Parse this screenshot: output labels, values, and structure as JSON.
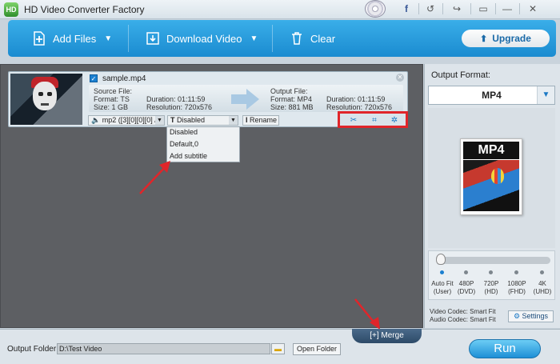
{
  "app": {
    "title": "HD Video Converter Factory"
  },
  "titlebar": {
    "icons": [
      "disc-icon",
      "facebook-icon",
      "undo-icon",
      "wrench-icon",
      "chat-icon",
      "minimize-icon",
      "close-icon"
    ],
    "glyphs": {
      "facebook": "f",
      "undo": "↺",
      "wrench": "↪",
      "chat": "▭",
      "minimize": "—",
      "close": "✕"
    }
  },
  "toolbar": {
    "add_files": "Add Files",
    "download_video": "Download Video",
    "clear": "Clear",
    "upgrade": "Upgrade"
  },
  "file": {
    "name": "sample.mp4",
    "source": {
      "label": "Source File:",
      "format": "Format: TS",
      "duration": "Duration: 01:11:59",
      "size": "Size: 1 GB",
      "resolution": "Resolution: 720x576"
    },
    "output": {
      "label": "Output File:",
      "format": "Format: MP4",
      "duration": "Duration: 01:11:59",
      "size": "Size: 881 MB",
      "resolution": "Resolution: 720x576"
    },
    "audio_track": "mp2 ([3][0][0][0] /...",
    "subtitle": "Disabled",
    "rename": "Rename"
  },
  "subtitle_menu": {
    "options": [
      "Disabled",
      "Default,0",
      "Add subtitle"
    ]
  },
  "right_panel": {
    "title": "Output Format:",
    "format": "MP4",
    "preview_label": "MP4",
    "resolutions": [
      {
        "line1": "Auto Fit",
        "line2": "(User)"
      },
      {
        "line1": "480P",
        "line2": "(DVD)"
      },
      {
        "line1": "720P",
        "line2": "(HD)"
      },
      {
        "line1": "1080P",
        "line2": "(FHD)"
      },
      {
        "line1": "4K",
        "line2": "(UHD)"
      }
    ],
    "selected_resolution": 0,
    "video_codec": "Video Codec: Smart Fit",
    "audio_codec": "Audio Codec: Smart Fit",
    "settings": "Settings"
  },
  "bottom": {
    "output_folder_label": "Output Folder:",
    "output_folder_value": "D:\\Test Video",
    "open_folder": "Open Folder",
    "merge": "Merge",
    "merge_icon": "[+]",
    "run": "Run"
  },
  "colors": {
    "toolbar": "#1a8bd0",
    "highlight": "#e0252a",
    "accent": "#1a7fd0"
  }
}
